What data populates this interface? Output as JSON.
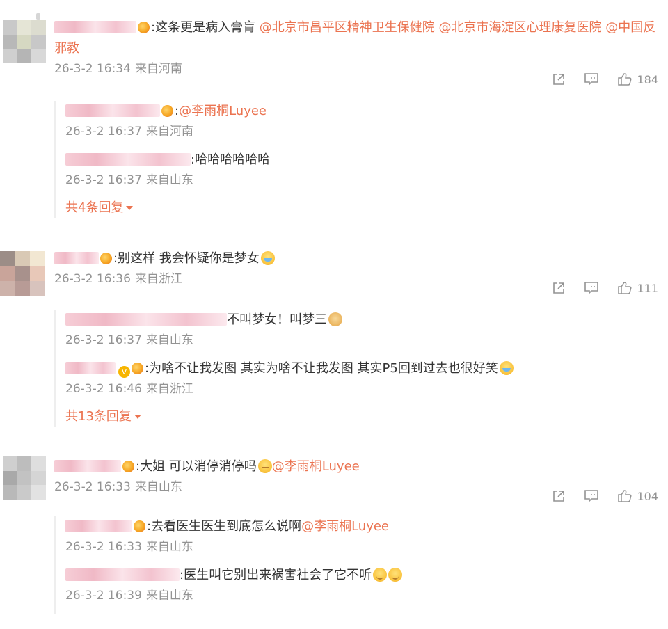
{
  "comments": [
    {
      "text": ":这条更是病入膏肓 ",
      "mentions": [
        "@北京市昌平区精神卫生保健院",
        "@北京市海淀区心理康复医院",
        "@中国反邪教"
      ],
      "time": "26-3-2 16:34",
      "location": "来自河南",
      "likes": "184",
      "replies": [
        {
          "text": ":",
          "mention": "@李雨桐Luyee",
          "time": "26-3-2 16:37",
          "location": "来自河南"
        },
        {
          "text": ":哈哈哈哈哈哈",
          "time": "26-3-2 16:37",
          "location": "来自山东"
        }
      ],
      "more_label": "共4条回复"
    },
    {
      "text": ":别这样 我会怀疑你是梦女",
      "time": "26-3-2 16:36",
      "location": "来自浙江",
      "likes": "111",
      "replies": [
        {
          "text": "不叫梦女！叫梦三",
          "time": "26-3-2 16:37",
          "location": "来自山东"
        },
        {
          "text": ":为啥不让我发图 其实为啥不让我发图 其实P5回到过去也很好笑",
          "time": "26-3-2 16:46",
          "location": "来自浙江"
        }
      ],
      "more_label": "共13条回复"
    },
    {
      "text": ":大姐 可以消停消停吗",
      "mention": "@李雨桐Luyee",
      "time": "26-3-2 16:33",
      "location": "来自山东",
      "likes": "104",
      "replies": [
        {
          "text": ":去看医生医生到底怎么说啊",
          "mention": "@李雨桐Luyee",
          "time": "26-3-2 16:33",
          "location": "来自山东"
        },
        {
          "text": ":医生叫它别出来祸害社会了它不听",
          "time": "26-3-2 16:39",
          "location": "来自山东"
        }
      ]
    }
  ],
  "vip_badge": "V",
  "icons": {
    "share": "share-icon",
    "comment": "comment-icon",
    "like": "thumbs-up-icon"
  },
  "colors": {
    "accent": "#eb7350",
    "meta": "#939393",
    "text": "#333333"
  }
}
